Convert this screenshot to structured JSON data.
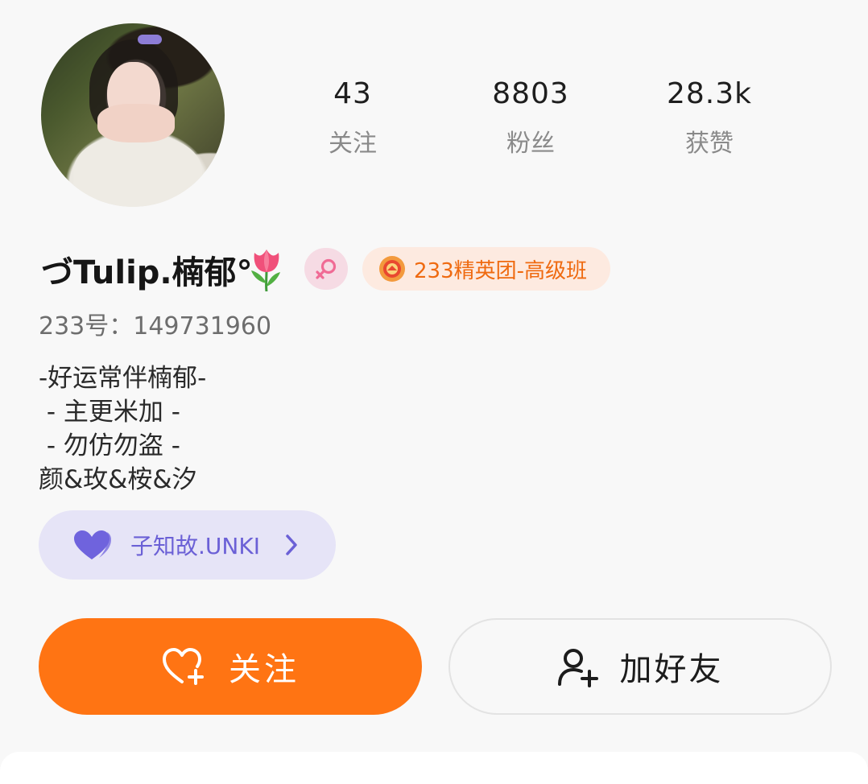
{
  "profile": {
    "nickname": "づTulip.楠郁°",
    "uid_text": "233号：149731960",
    "bio": [
      "-好运常伴楠郁-",
      " - 主更米加 -",
      " - 勿仿勿盗 -",
      "颜&玫&桉&汐"
    ],
    "club_badge": "233精英团-高级班"
  },
  "stats": {
    "following_count": "43",
    "following_label": "关注",
    "fans_count": "8803",
    "fans_label": "粉丝",
    "likes_count": "28.3k",
    "likes_label": "获赞"
  },
  "group": {
    "name": "子知故.UNKI"
  },
  "actions": {
    "follow_label": "关注",
    "add_friend_label": "加好友"
  },
  "colors": {
    "accent_orange": "#ff7413",
    "club_text": "#ef6a10",
    "group_purple": "#6b60d6",
    "gender_pink": "#f06b95"
  },
  "icons": [
    "tulip-icon",
    "female-icon",
    "club-emblem-icon",
    "heart-icon",
    "chevron-right-icon",
    "heart-plus-icon",
    "add-user-icon"
  ]
}
